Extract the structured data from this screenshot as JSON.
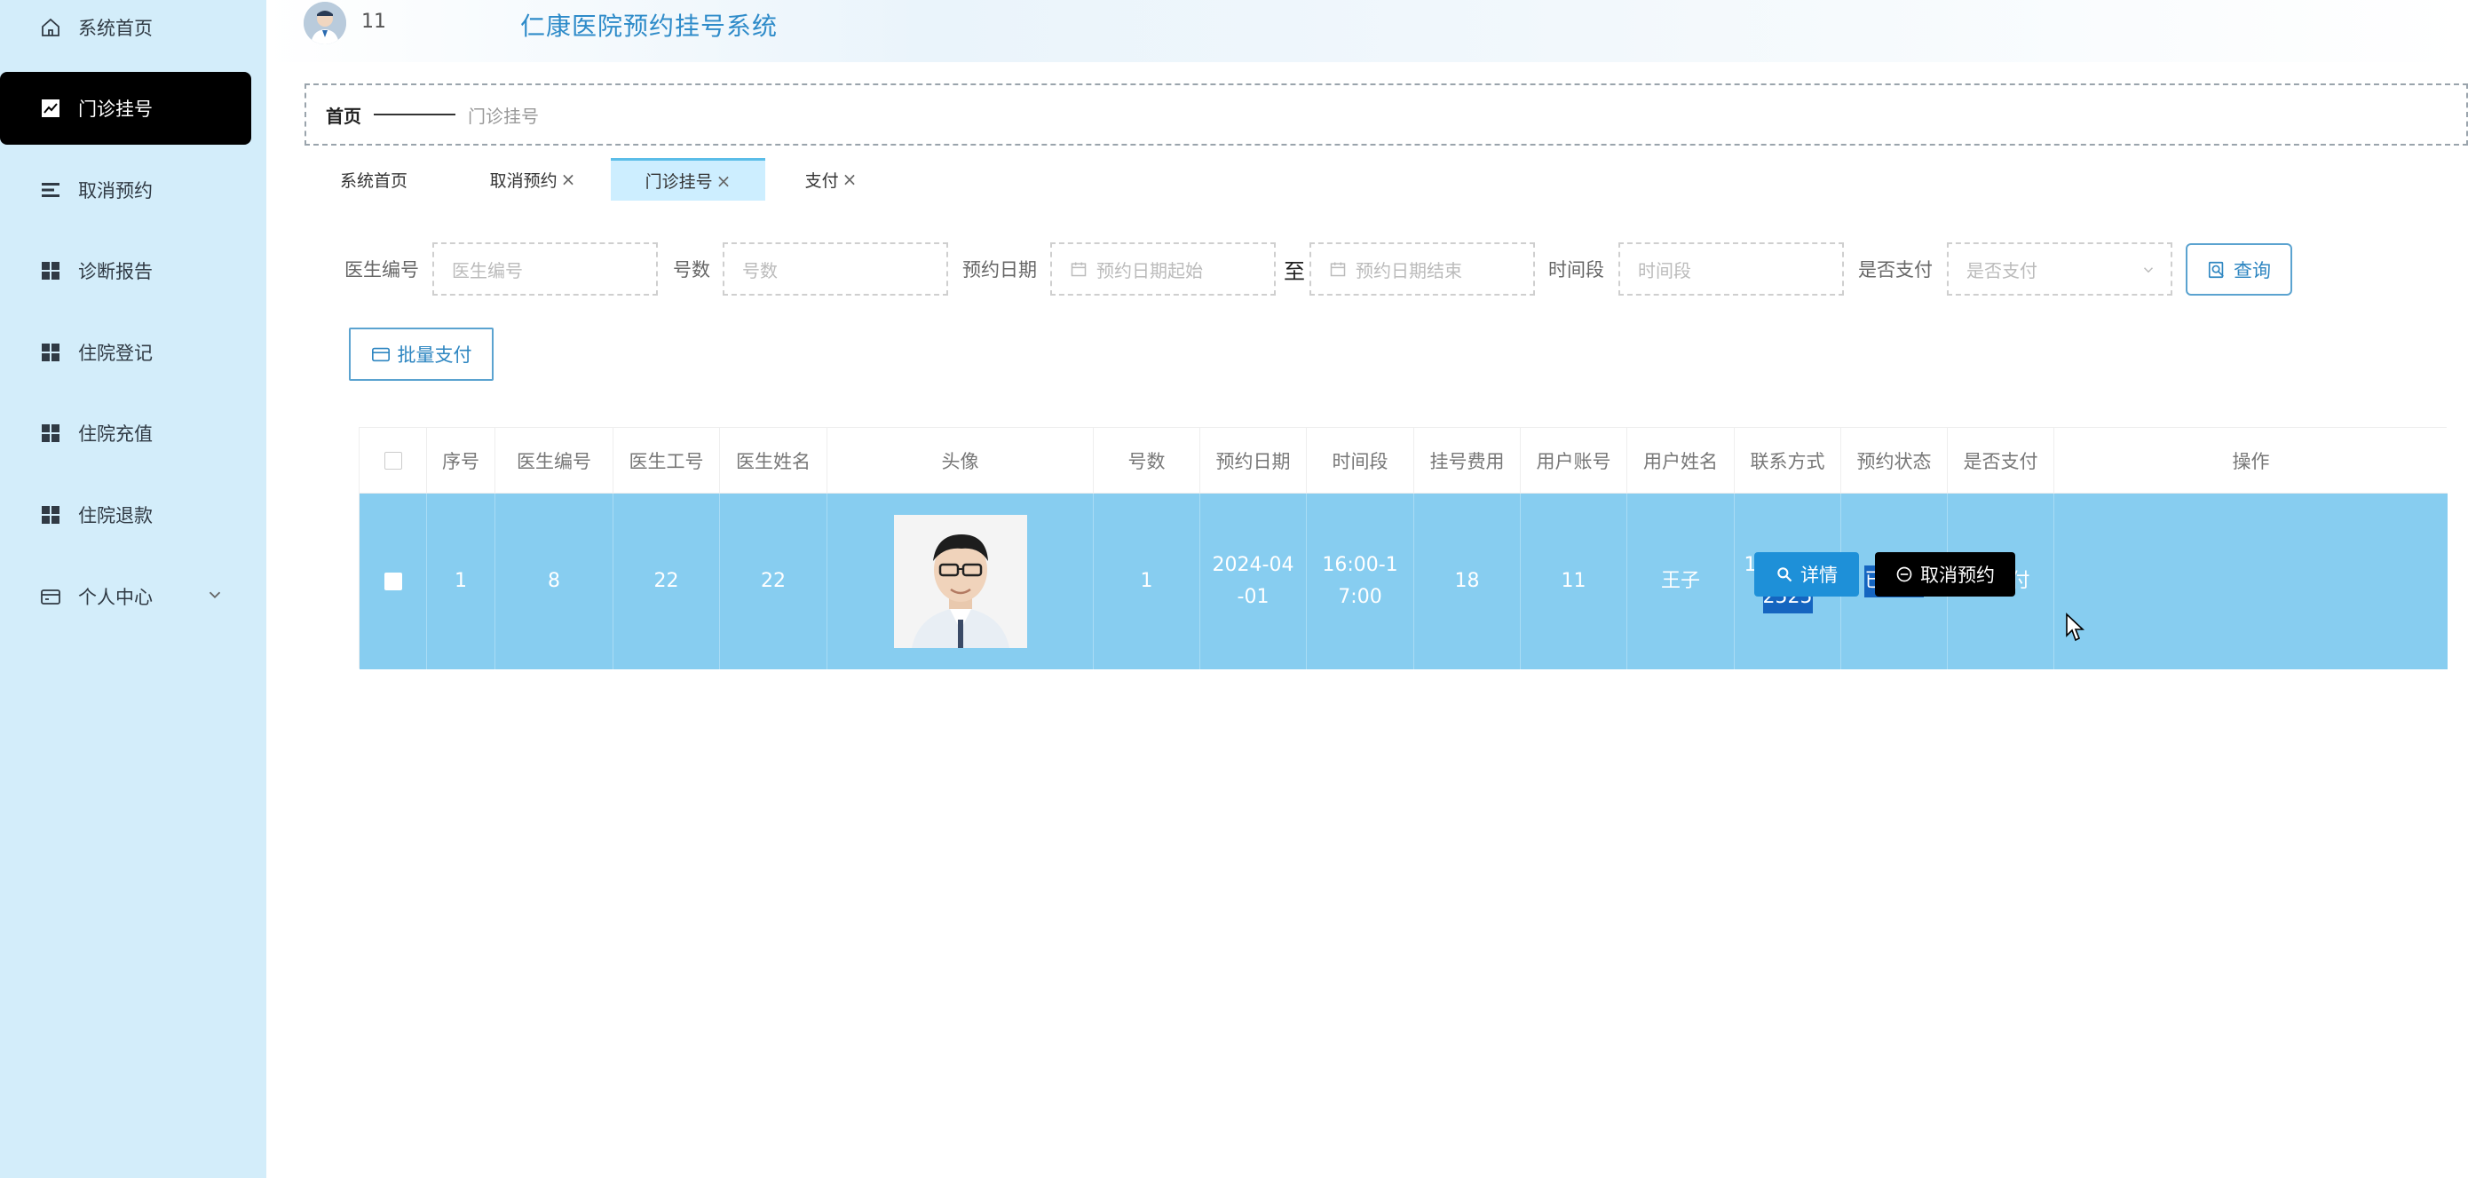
{
  "sidebar": {
    "items": [
      {
        "label": "系统首页",
        "icon": "home-icon"
      },
      {
        "label": "门诊挂号",
        "icon": "trend-icon"
      },
      {
        "label": "取消预约",
        "icon": "list-icon"
      },
      {
        "label": "诊断报告",
        "icon": "grid-icon"
      },
      {
        "label": "住院登记",
        "icon": "grid-icon"
      },
      {
        "label": "住院充值",
        "icon": "grid-icon"
      },
      {
        "label": "住院退款",
        "icon": "grid-icon"
      },
      {
        "label": "个人中心",
        "icon": "wallet-icon"
      }
    ]
  },
  "header": {
    "user_name": "11",
    "title": "仁康医院预约挂号系统"
  },
  "breadcrumb": {
    "home": "首页",
    "current": "门诊挂号"
  },
  "tabs": [
    {
      "label": "系统首页"
    },
    {
      "label": "取消预约"
    },
    {
      "label": "门诊挂号"
    },
    {
      "label": "支付"
    }
  ],
  "tab_close": "×",
  "search": {
    "doctor_no_label": "医生编号",
    "doctor_no_placeholder": "医生编号",
    "number_label": "号数",
    "number_placeholder": "号数",
    "date_label": "预约日期",
    "date_start_placeholder": "预约日期起始",
    "date_to": "至",
    "date_end_placeholder": "预约日期结束",
    "period_label": "时间段",
    "period_placeholder": "时间段",
    "paid_label": "是否支付",
    "paid_placeholder": "是否支付",
    "query_button": "查询"
  },
  "batch_pay_button": "批量支付",
  "table": {
    "columns": [
      "序号",
      "医生编号",
      "医生工号",
      "医生姓名",
      "头像",
      "号数",
      "预约日期",
      "时间段",
      "挂号费用",
      "用户账号",
      "用户姓名",
      "联系方式",
      "预约状态",
      "是否支付",
      "操作"
    ],
    "rows": [
      {
        "index": "1",
        "doctor_no": "8",
        "doctor_job_no": "22",
        "doctor_name": "22",
        "number": "1",
        "date": "2024-04-01",
        "date_line1": "2024-04",
        "date_line2": "-01",
        "period_line1": "16:00-1",
        "period_line2": "7:00",
        "fee": "18",
        "user_account": "11",
        "user_name": "王子",
        "contact_line1": "1352525",
        "contact_line2": "2525",
        "status": "已预约",
        "paid": "已支付",
        "detail_button": "详情",
        "cancel_button": "取消预约"
      }
    ]
  },
  "colors": {
    "sidebar_bg": "#d3edfa",
    "active_menu_bg": "#000000",
    "row_bg": "#87cdf0",
    "accent": "#2e8bc9",
    "detail_button_bg": "#1e90d8",
    "selection_highlight": "#1565c0"
  }
}
